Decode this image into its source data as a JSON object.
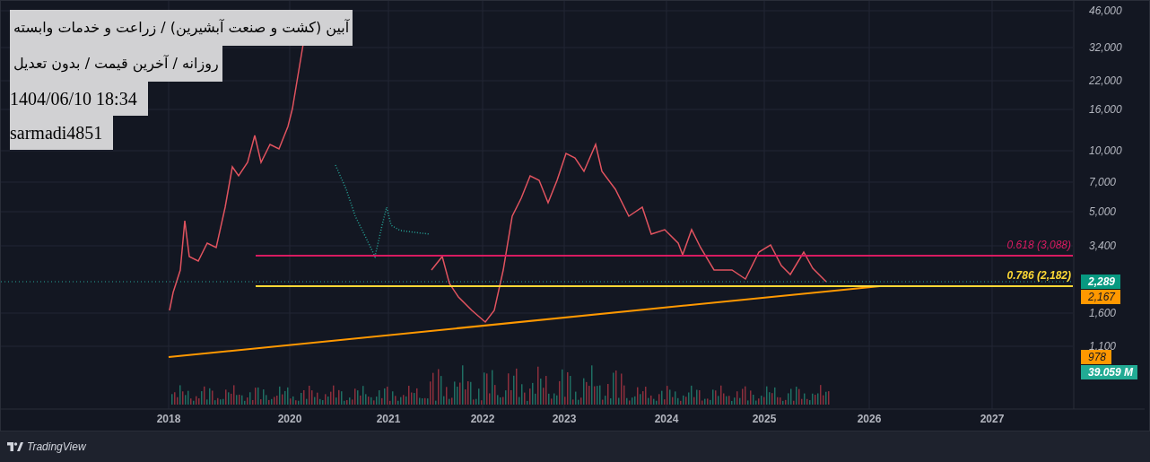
{
  "info_boxes": [
    {
      "text": "آبین (کشت و صنعت آبشیرین) / زراعت و خدمات وابسته",
      "kind": "persian"
    },
    {
      "text": "روزانه / آخرین قیمت / بدون تعدیل",
      "kind": "persian"
    },
    {
      "text": "1404/06/10 18:34",
      "kind": "latin"
    },
    {
      "text": "sarmadi4851",
      "kind": "latin"
    }
  ],
  "price_axis": [
    "46,000",
    "32,000",
    "22,000",
    "16,000",
    "10,000",
    "7,000",
    "5,000",
    "3,400",
    "1,600",
    "1,100"
  ],
  "time_axis": [
    "2018",
    "2020",
    "2021",
    "2022",
    "2023",
    "2024",
    "2025",
    "2026",
    "2027"
  ],
  "fib_levels": [
    {
      "label": "0.618 (3,088)",
      "color": "#d81b60"
    },
    {
      "label": "0.786 (2,182)",
      "color": "#fdd835"
    }
  ],
  "price_tags": [
    {
      "label": "2,289",
      "color": "#089981"
    },
    {
      "label": "2,167",
      "color": "#ff9800"
    },
    {
      "label": "978",
      "color": "#ff9800"
    },
    {
      "label": "39.059 M",
      "color": "#22ab94"
    }
  ],
  "footer": {
    "brand": "TradingView"
  }
}
